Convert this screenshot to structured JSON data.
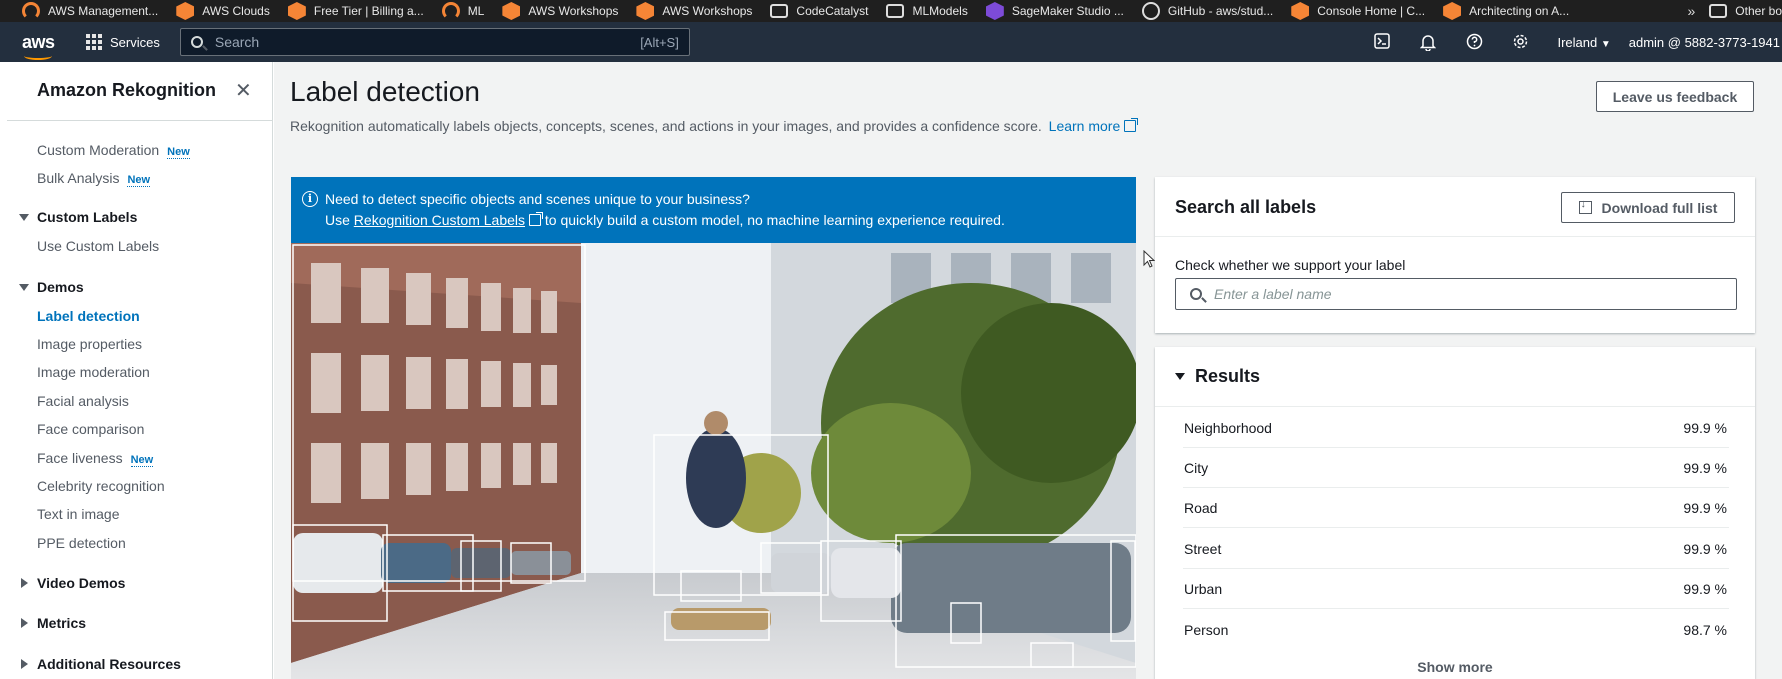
{
  "bookmarks": [
    {
      "label": "AWS Management...",
      "icon": "hex-orange-icon"
    },
    {
      "label": "AWS Clouds",
      "icon": "hex-orange-icon"
    },
    {
      "label": "Free Tier | Billing a...",
      "icon": "hex-orange-icon"
    },
    {
      "label": "ML",
      "icon": "ring-icon"
    },
    {
      "label": "AWS Workshops",
      "icon": "hex-orange-icon"
    },
    {
      "label": "AWS Workshops",
      "icon": "hex-orange-icon"
    },
    {
      "label": "CodeCatalyst",
      "icon": "folder-icon"
    },
    {
      "label": "MLModels",
      "icon": "folder-icon"
    },
    {
      "label": "SageMaker Studio ...",
      "icon": "hex-purple-icon"
    },
    {
      "label": "GitHub - aws/stud...",
      "icon": "globe-icon"
    },
    {
      "label": "Console Home | C...",
      "icon": "hex-orange-icon"
    },
    {
      "label": "Architecting on A...",
      "icon": "hex-orange-icon"
    }
  ],
  "bookmarks_more": "»",
  "bookmarks_other": "Other bo",
  "topnav": {
    "logo": "aws",
    "services": "Services",
    "search_placeholder": "Search",
    "search_shortcut": "[Alt+S]",
    "region": "Ireland",
    "account": "admin @ 5882-3773-1941",
    "icons": [
      "cloudshell-icon",
      "bell-icon",
      "help-icon",
      "settings-icon"
    ]
  },
  "sidebar": {
    "title": "Amazon Rekognition",
    "new_badge": "New",
    "items": [
      {
        "label": "Custom Moderation",
        "new": true
      },
      {
        "label": "Bulk Analysis",
        "new": true
      }
    ],
    "sections": {
      "custom_labels": {
        "label": "Custom Labels",
        "items": [
          "Use Custom Labels"
        ]
      },
      "demos": {
        "label": "Demos",
        "items": [
          "Label detection",
          "Image properties",
          "Image moderation",
          "Facial analysis",
          "Face comparison",
          "Face liveness",
          "Celebrity recognition",
          "Text in image",
          "PPE detection"
        ]
      },
      "video_demos": "Video Demos",
      "metrics": "Metrics",
      "additional_resources": "Additional Resources"
    }
  },
  "main": {
    "title": "Label detection",
    "feedback": "Leave us feedback",
    "description": "Rekognition automatically labels objects, concepts, scenes, and actions in your images, and provides a confidence score.",
    "learn_more": "Learn more",
    "banner": {
      "line1": "Need to detect specific objects and scenes unique to your business?",
      "line2_prefix": "Use",
      "line2_link": "Rekognition Custom Labels",
      "line2_suffix": "to quickly build a custom model, no machine learning experience required."
    }
  },
  "search_panel": {
    "title": "Search all labels",
    "download": "Download full list",
    "label": "Check whether we support your label",
    "placeholder": "Enter a label name"
  },
  "results": {
    "title": "Results",
    "rows": [
      {
        "label": "Neighborhood",
        "value": "99.9 %"
      },
      {
        "label": "City",
        "value": "99.9 %"
      },
      {
        "label": "Road",
        "value": "99.9 %"
      },
      {
        "label": "Street",
        "value": "99.9 %"
      },
      {
        "label": "Urban",
        "value": "99.9 %"
      },
      {
        "label": "Person",
        "value": "98.7 %"
      }
    ],
    "show_more": "Show more"
  },
  "colors": {
    "aws_nav": "#232f3e",
    "aws_orange": "#ff9900",
    "link_blue": "#0073bb",
    "banner_blue": "#0073bb"
  }
}
